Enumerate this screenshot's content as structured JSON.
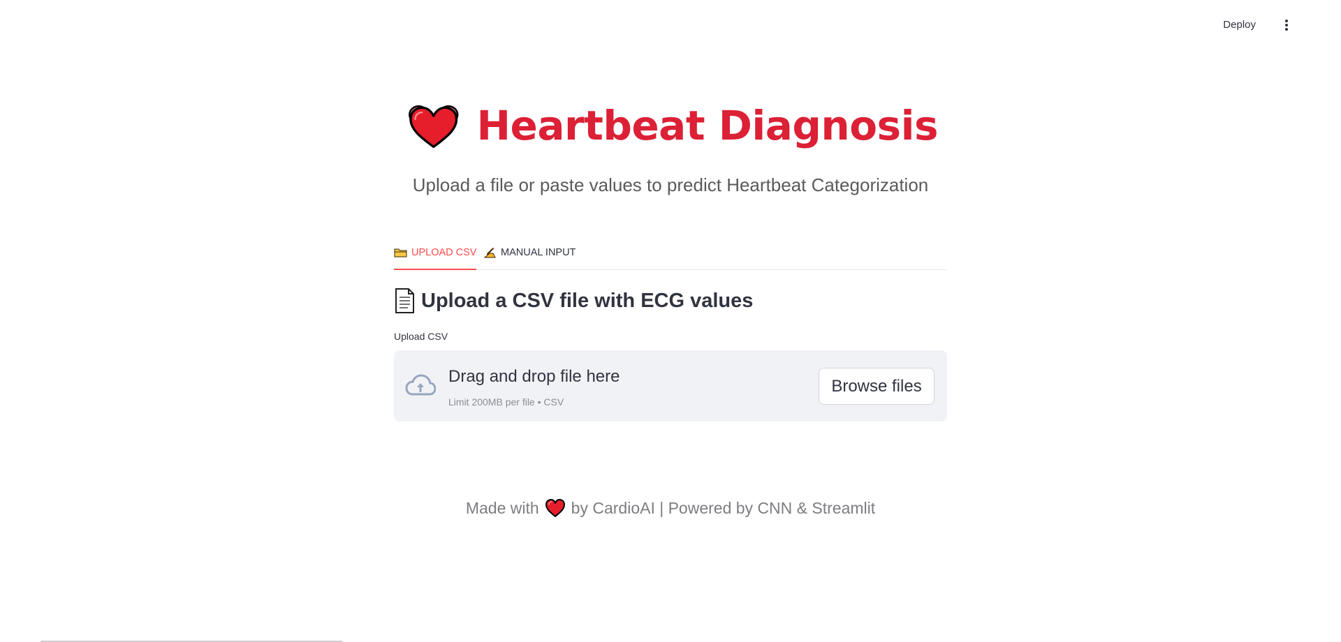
{
  "header": {
    "deploy_label": "Deploy",
    "menu_icon": "kebab-menu-icon"
  },
  "hero": {
    "icon": "heart-icon",
    "title": "Heartbeat Diagnosis",
    "subtitle": "Upload a file or paste values to predict Heartbeat Categorization"
  },
  "tabs": [
    {
      "label": "UPLOAD CSV",
      "icon": "folder-icon",
      "active": true
    },
    {
      "label": "MANUAL INPUT",
      "icon": "writing-hand-icon",
      "active": false
    }
  ],
  "upload_section": {
    "icon": "document-icon",
    "heading": "Upload a CSV file with ECG values",
    "field_label": "Upload CSV",
    "dropzone": {
      "icon": "cloud-upload-icon",
      "title": "Drag and drop file here",
      "subtitle": "Limit 200MB per file • CSV",
      "button_label": "Browse files"
    }
  },
  "footer": {
    "prefix": "Made with",
    "icon": "heart-icon",
    "suffix": "by CardioAI | Powered by CNN & Streamlit"
  },
  "colors": {
    "title": "#dc2035",
    "accent": "#ff4b4b",
    "dropzone_bg": "#f0f2f6"
  }
}
